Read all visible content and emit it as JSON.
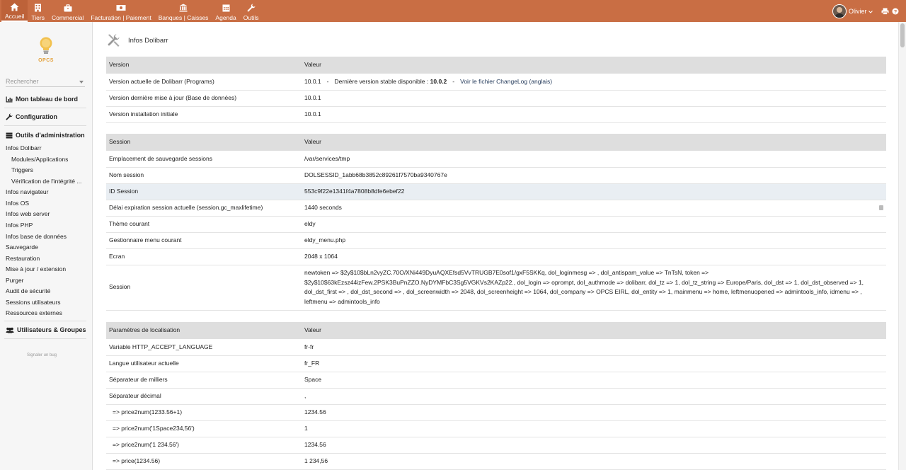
{
  "topmenu": [
    {
      "label": "Accueil",
      "icon": "home-icon",
      "active": true
    },
    {
      "label": "Tiers",
      "icon": "building-icon"
    },
    {
      "label": "Commercial",
      "icon": "briefcase-icon"
    },
    {
      "label": "Facturation | Paiement",
      "icon": "banknote-icon"
    },
    {
      "label": "Banques | Caisses",
      "icon": "bank-icon"
    },
    {
      "label": "Agenda",
      "icon": "calendar-icon"
    },
    {
      "label": "Outils",
      "icon": "wrench-icon"
    }
  ],
  "user": {
    "name": "Olivier"
  },
  "colors": {
    "topbar": "#c96e44",
    "link": "#263c5c",
    "header_row": "#dedede",
    "highlight_row": "#e9eef3"
  },
  "sidebar": {
    "logo_text": "OPCS",
    "search_placeholder": "Rechercher",
    "dashboard": "Mon tableau de bord",
    "configuration": "Configuration",
    "admin_tools": "Outils d'administration",
    "items": [
      "Infos Dolibarr",
      "Modules/Applications",
      "Triggers",
      "Vérification de l'intégrité ...",
      "Infos navigateur",
      "Infos OS",
      "Infos web server",
      "Infos PHP",
      "Infos base de données",
      "Sauvegarde",
      "Restauration",
      "Mise à jour / extension",
      "Purger",
      "Audit de sécurité",
      "Sessions utilisateurs",
      "Ressources externes"
    ],
    "users_groups": "Utilisateurs & Groupes",
    "report_bug": "Signaler un bug"
  },
  "page": {
    "title": "Infos Dolibarr"
  },
  "version_table": {
    "header": [
      "Version",
      "Valeur"
    ],
    "current_label": "Version actuelle de Dolibarr (Programs)",
    "current_value": "10.0.1",
    "stable_label": "Dernière version stable disponible :",
    "stable_value": "10.0.2",
    "changelog_link": "Voir le fichier ChangeLog (anglais)",
    "rows": [
      [
        "Version dernière mise à jour (Base de données)",
        "10.0.1"
      ],
      [
        "Version installation initiale",
        "10.0.1"
      ]
    ]
  },
  "session_table": {
    "header": [
      "Session",
      "Valeur"
    ],
    "rows": [
      [
        "Emplacement de sauvegarde sessions",
        "/var/services/tmp"
      ],
      [
        "Nom session",
        "DOLSESSID_1abb68b3852c89261f7570ba9340767e"
      ],
      [
        "ID Session",
        "553c9f22e1341f4a7808b8dfe6ebef22"
      ],
      [
        "Délai expiration session actuelle (session.gc_maxlifetime)",
        "1440 seconds"
      ],
      [
        "Thème courant",
        "eldy"
      ],
      [
        "Gestionnaire menu courant",
        "eldy_menu.php"
      ],
      [
        "Ecran",
        "2048 x 1064"
      ]
    ],
    "session_label": "Session",
    "session_value": "newtoken => $2y$10$bLn2vyZC.70O/XNi449DyuAQXEfsd5VvTRUGB7E0sof1/gxF5SKKq, dol_loginmesg => , dol_antispam_value => TnTsN, token => $2y$10$63kEzsz44izFew.2PSK3BuPnZZO.NyDYMFbC3Sg5VGKVs2KAZp22., dol_login => oprompt, dol_authmode => dolibarr, dol_tz => 1, dol_tz_string => Europe/Paris, dol_dst => 1, dol_dst_observed => 1, dol_dst_first => , dol_dst_second => , dol_screenwidth => 2048, dol_screenheight => 1064, dol_company => OPCS EIRL, dol_entity => 1, mainmenu => home, leftmenuopened => admintools_info, idmenu => , leftmenu => admintools_info"
  },
  "locale_table": {
    "header": [
      "Paramètres de localisation",
      "Valeur"
    ],
    "rows": [
      [
        "Variable HTTP_ACCEPT_LANGUAGE",
        "fr-fr"
      ],
      [
        "Langue utilisateur actuelle",
        "fr_FR"
      ],
      [
        "Séparateur de milliers",
        "Space"
      ],
      [
        "Séparateur décimal",
        ","
      ],
      [
        "=> price2num(1233.56+1)",
        "1234.56"
      ],
      [
        "=> price2num('1Space234,56')",
        "1"
      ],
      [
        "=> price2num('1 234.56')",
        "1234.56"
      ],
      [
        "=> price(1234.56)",
        "1 234,56"
      ]
    ]
  }
}
